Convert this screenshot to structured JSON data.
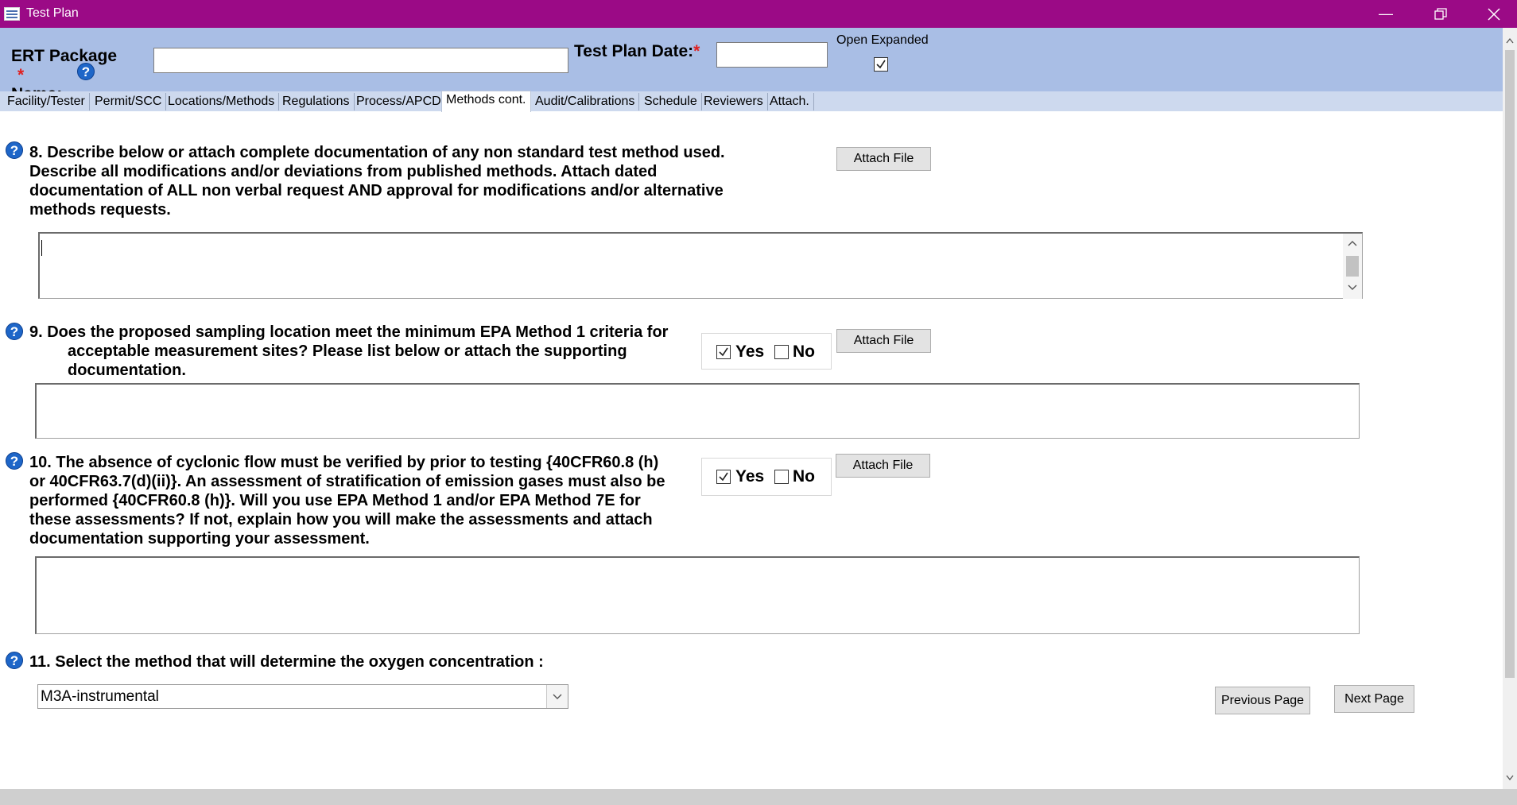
{
  "window": {
    "title": "Test Plan"
  },
  "header": {
    "package_label_1": "ERT Package",
    "package_label_2": "Name:",
    "required_mark": "*",
    "package_value": "",
    "date_label": "Test Plan Date:",
    "date_value": "",
    "open_expanded_label": "Open Expanded",
    "open_expanded_checked": true
  },
  "tabs": [
    {
      "label": "Facility/Tester"
    },
    {
      "label": "Permit/SCC"
    },
    {
      "label": "Locations/Methods"
    },
    {
      "label": "Regulations"
    },
    {
      "label": "Process/APCD"
    },
    {
      "label": "Methods cont.",
      "active": true
    },
    {
      "label": "Audit/Calibrations"
    },
    {
      "label": "Schedule"
    },
    {
      "label": "Reviewers"
    },
    {
      "label": "Attach."
    }
  ],
  "questions": {
    "q8": {
      "line1": "8.  Describe below or attach complete documentation of any non standard test method used.",
      "line2": "Describe all modifications and/or deviations from published methods. Attach dated",
      "line3": "documentation of ALL non verbal request AND approval for modifications and/or alternative",
      "line4": "methods requests.",
      "attach_label": "Attach File",
      "answer": ""
    },
    "q9": {
      "line1": "9.  Does the proposed sampling location meet the minimum EPA Method 1 criteria for",
      "line2": "acceptable measurement sites?  Please list below or attach the supporting",
      "line3": "documentation.",
      "yes_label": "Yes",
      "no_label": "No",
      "yes_checked": true,
      "no_checked": false,
      "attach_label": "Attach File",
      "answer": ""
    },
    "q10": {
      "line1": "10.  The absence of cyclonic flow must be verified by prior to testing {40CFR60.8 (h)",
      "line2": "or 40CFR63.7(d)(ii)}. An assessment of stratification of emission gases must also be",
      "line3": "performed {40CFR60.8 (h)}. Will you use EPA Method 1 and/or EPA Method 7E for",
      "line4": "these assessments? If not, explain how you will make the assessments and attach",
      "line5": "documentation supporting your assessment.",
      "yes_label": "Yes",
      "no_label": "No",
      "yes_checked": true,
      "no_checked": false,
      "attach_label": "Attach File",
      "answer": ""
    },
    "q11": {
      "line1": "11.  Select the method that will determine the oxygen concentration :",
      "selected": "M3A-instrumental"
    }
  },
  "nav": {
    "previous_label": "Previous Page",
    "next_label": "Next Page"
  },
  "icons": {
    "help": "question-mark-icon",
    "minimize": "minimize-icon",
    "restore": "restore-icon",
    "close": "close-icon"
  },
  "colors": {
    "titlebar": "#9b0a86",
    "header": "#a9bee5",
    "help_icon": "#1e66c8",
    "required": "#e02020"
  }
}
